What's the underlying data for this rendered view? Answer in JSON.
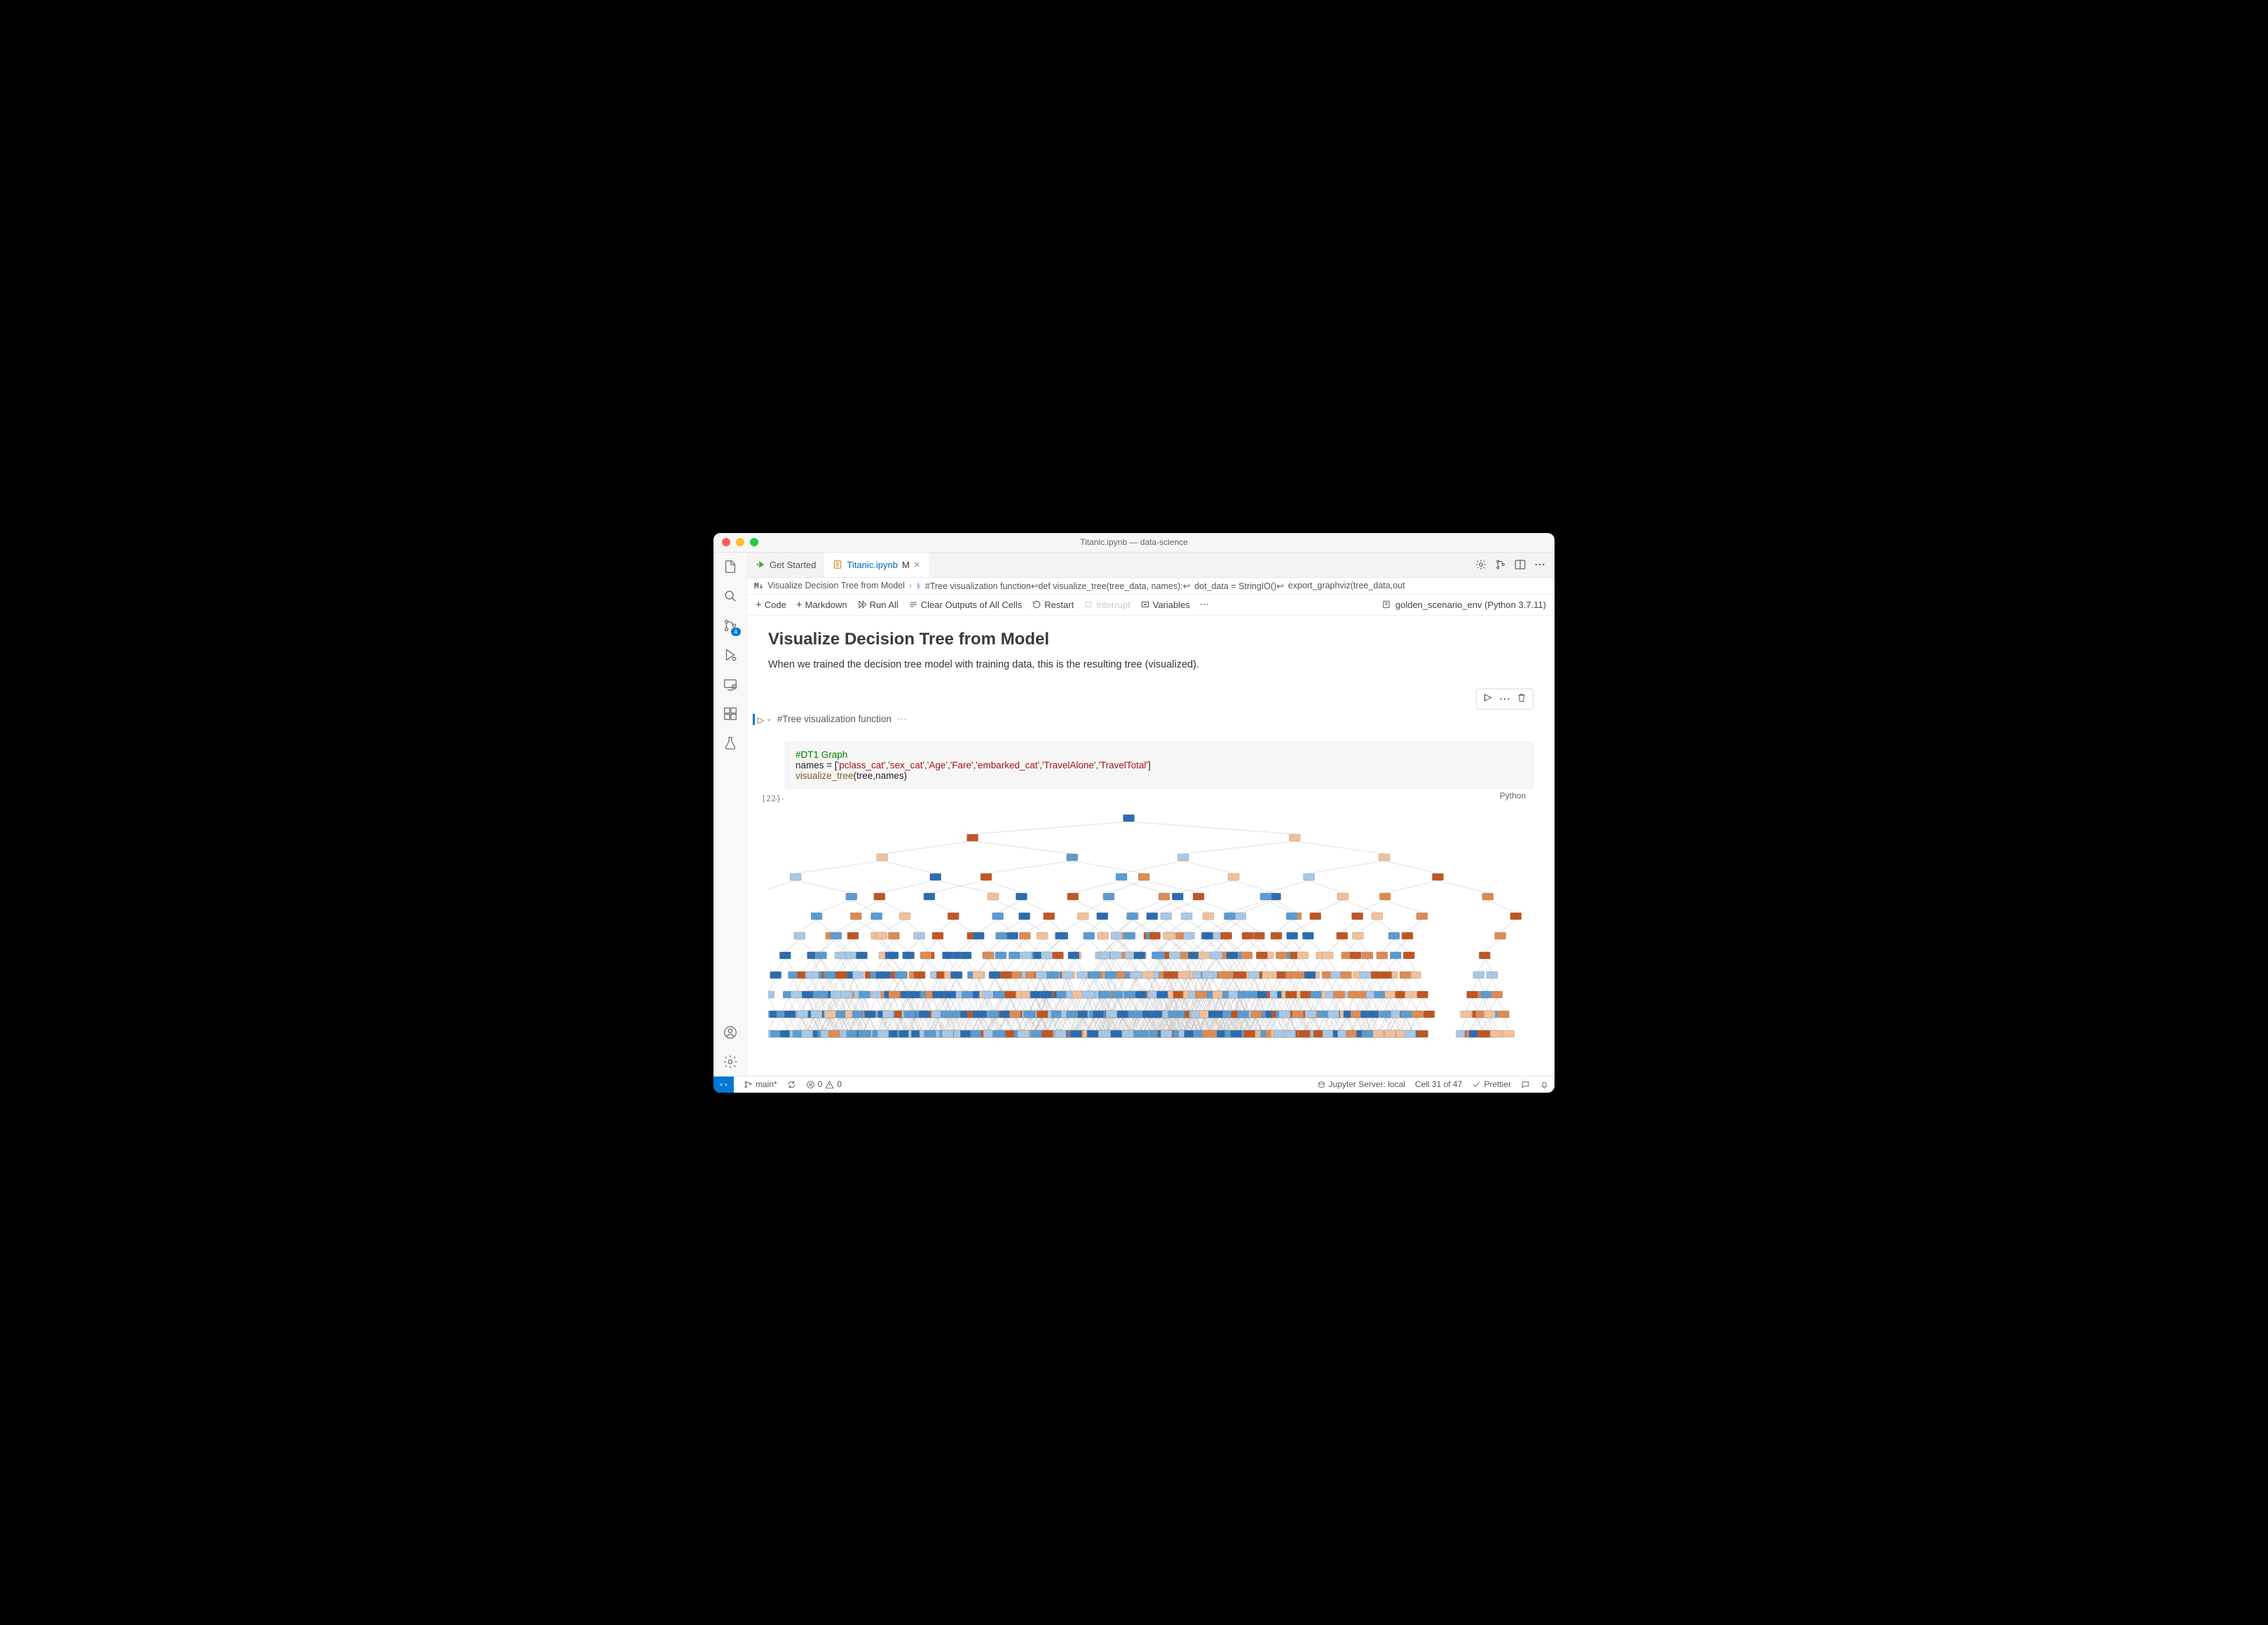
{
  "titlebar": {
    "title": "Titanic.ipynb — data-science"
  },
  "activity_bar": {
    "source_control_badge": "4"
  },
  "tabs": {
    "tab1_label": "Get Started",
    "tab2_label": "Titanic.ipynb",
    "tab2_modified": "M"
  },
  "breadcrumb": {
    "md_icon": "M↓",
    "item1": "Visualize Decision Tree from Model",
    "item2_prefix": "#Tree visualization function",
    "item2_def": "def visualize_tree(tree_data, names):",
    "item2_b": "dot_data = StringIO()",
    "item2_c": "export_graphviz(tree_data,out"
  },
  "nb_toolbar": {
    "code": "Code",
    "markdown": "Markdown",
    "run_all": "Run All",
    "clear": "Clear Outputs of All Cells",
    "restart": "Restart",
    "interrupt": "Interrupt",
    "variables": "Variables",
    "kernel": "golden_scenario_env (Python 3.7.11)"
  },
  "content": {
    "heading": "Visualize Decision Tree from Model",
    "para": "When we trained the decision tree model with training data, this is the resulting tree (visualized).",
    "collapsed_code": "#Tree visualization function",
    "exec_count": "[22]",
    "code_comment": "#DT1 Graph",
    "code_line1_a": "names = [",
    "code_line1_b": "'pclass_cat','sex_cat','Age','Fare','embarked_cat','TravelAlone','TravelTotal'",
    "code_line1_c": "]",
    "code_line2_fn": "visualize_tree",
    "code_line2_args": "(tree,names)",
    "lang": "Python"
  },
  "statusbar": {
    "branch": "main*",
    "errors": "0",
    "warnings": "0",
    "jupyter": "Jupyter Server: local",
    "cell": "Cell 31 of 47",
    "prettier": "Prettier"
  }
}
